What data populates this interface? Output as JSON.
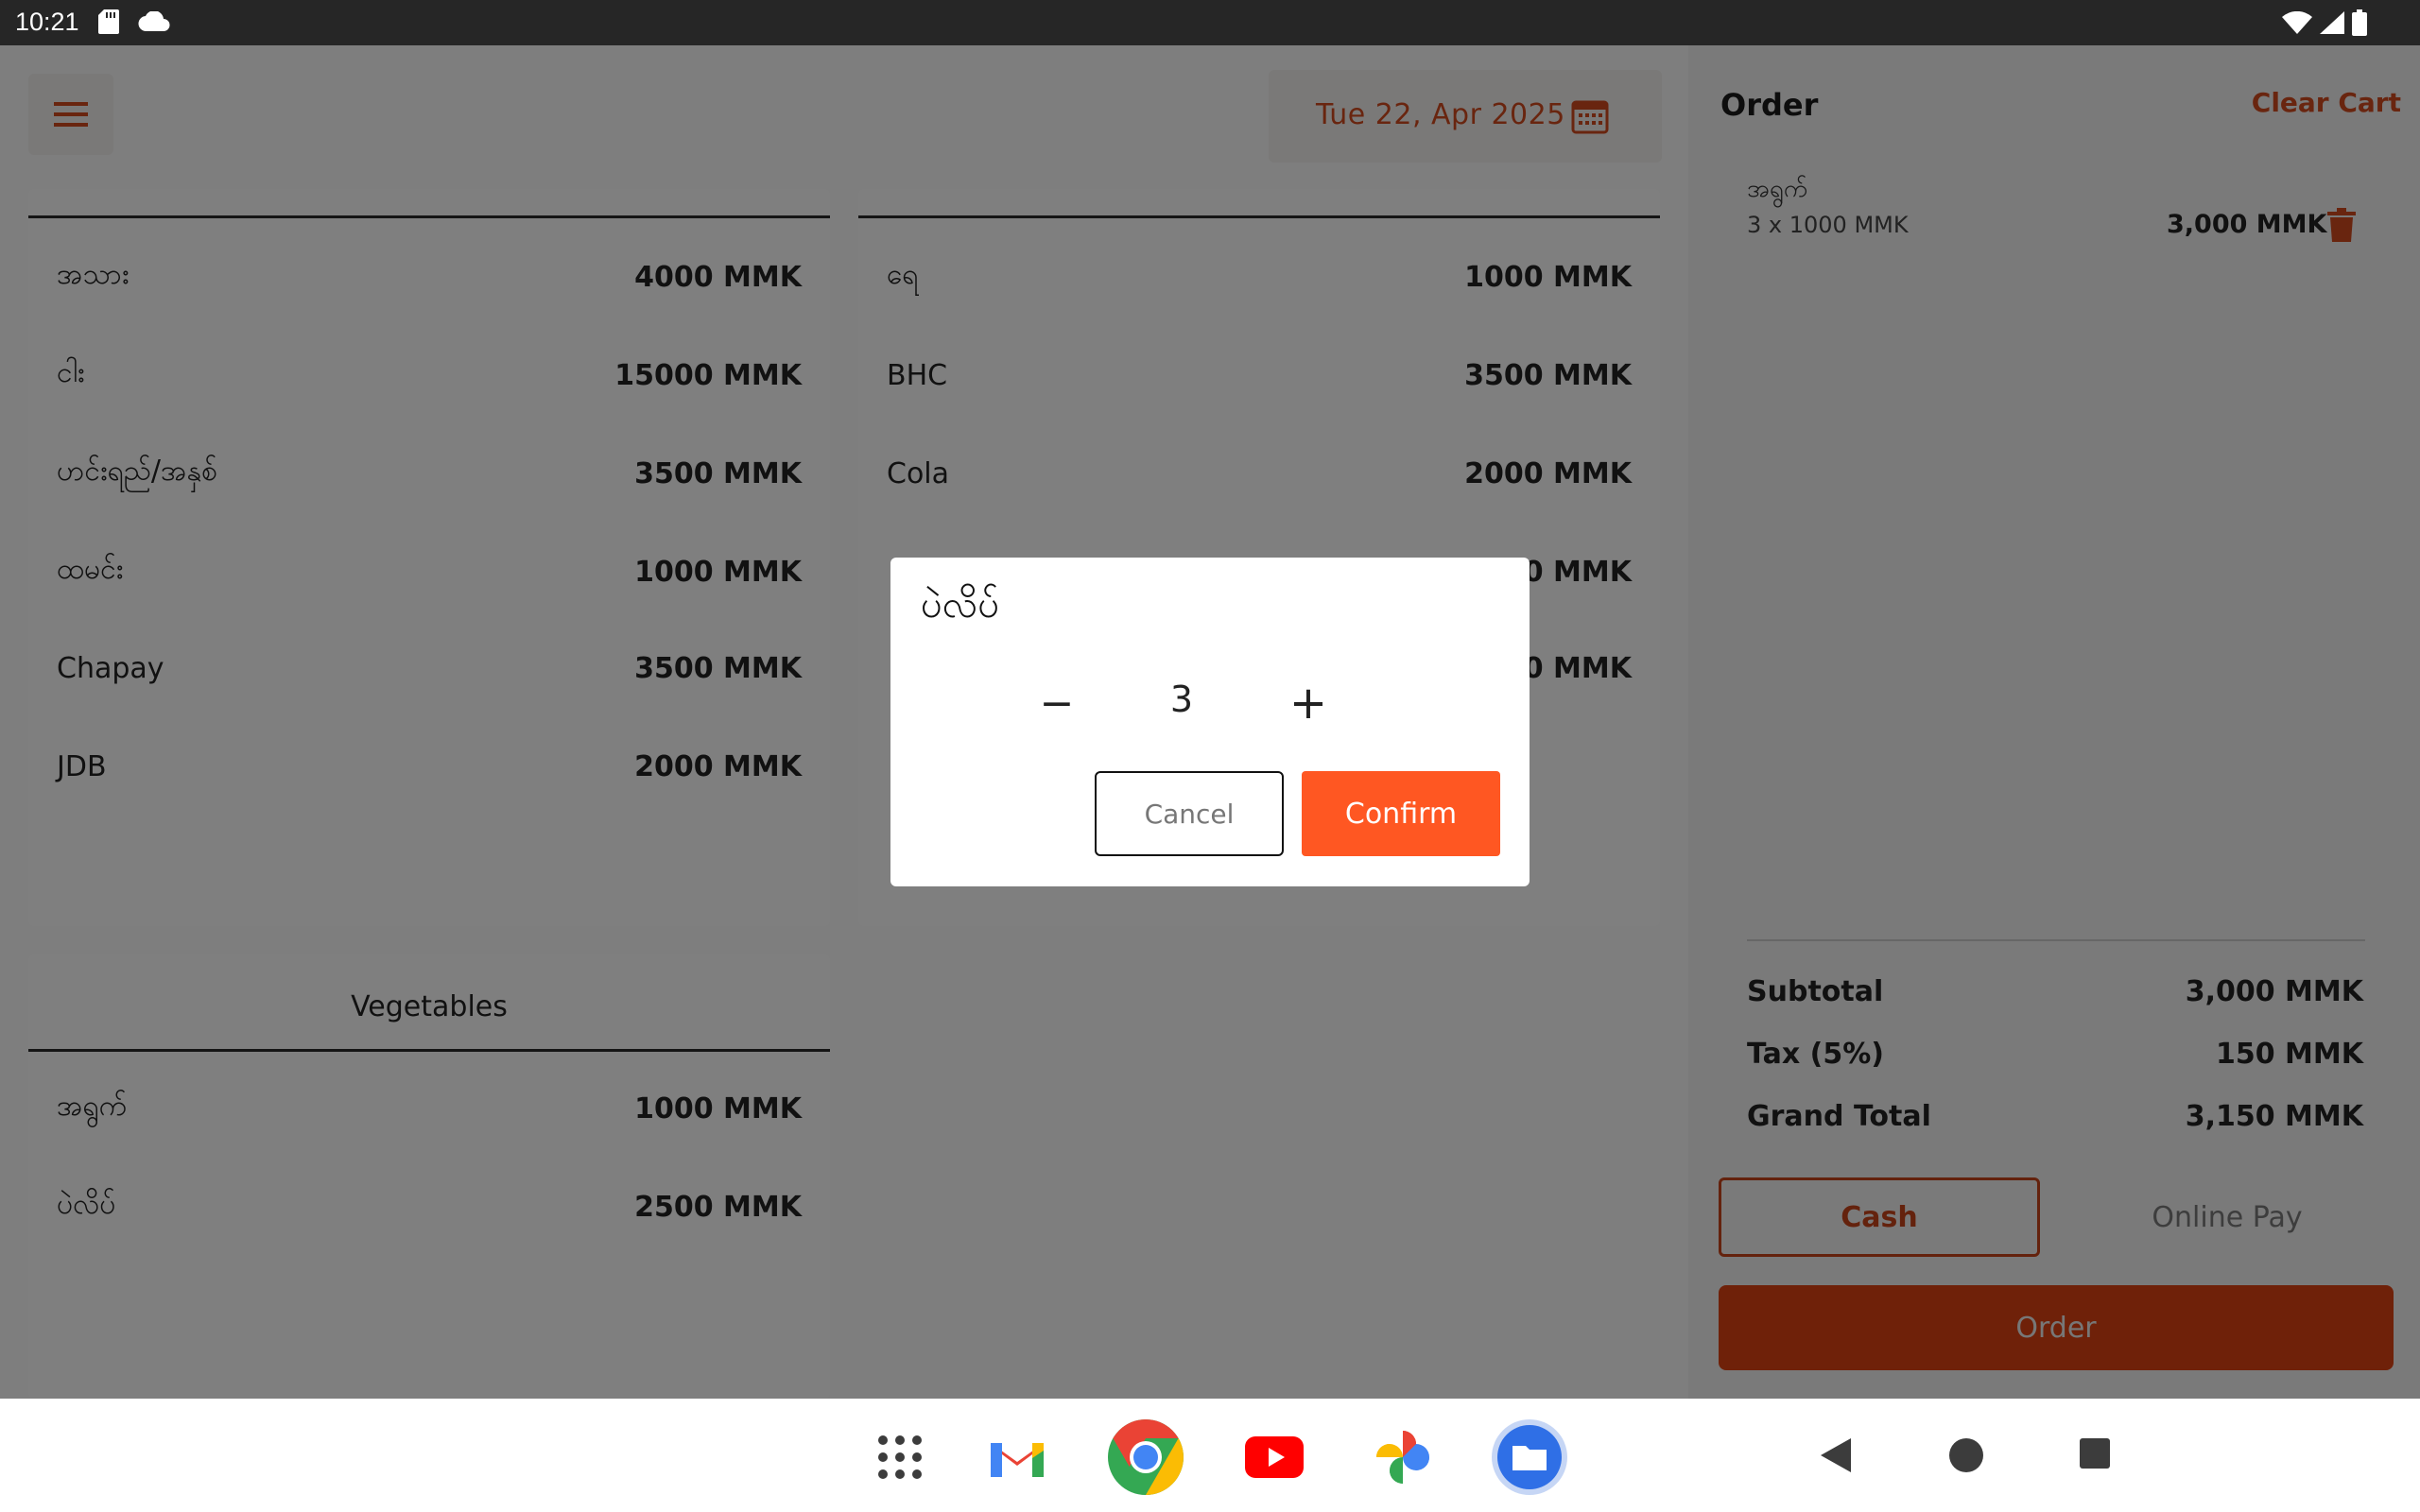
{
  "status_bar": {
    "time": "10:21"
  },
  "header": {
    "date": "Tue 22, Apr 2025"
  },
  "menu_cards": [
    {
      "title": "",
      "items": [
        {
          "name": "အသား",
          "price": "4000 MMK"
        },
        {
          "name": "ငါး",
          "price": "15000 MMK"
        },
        {
          "name": "ဟင်းရည်/အနှစ်",
          "price": "3500 MMK"
        },
        {
          "name": "ထမင်း",
          "price": "1000 MMK"
        },
        {
          "name": "Chapay",
          "price": "3500 MMK"
        },
        {
          "name": "JDB",
          "price": "2000 MMK"
        }
      ]
    },
    {
      "title": "",
      "items": [
        {
          "name": "ရေ",
          "price": "1000 MMK"
        },
        {
          "name": "BHC",
          "price": "3500 MMK"
        },
        {
          "name": "Cola",
          "price": "2000 MMK"
        },
        {
          "name": "",
          "price": "0 MMK"
        },
        {
          "name": "",
          "price": "0 MMK"
        }
      ]
    },
    {
      "title": "Vegetables",
      "items": [
        {
          "name": "အရွက်",
          "price": "1000 MMK"
        },
        {
          "name": "ပဲလိပ်",
          "price": "2500 MMK"
        }
      ]
    }
  ],
  "order": {
    "title": "Order",
    "clear_cart": "Clear Cart",
    "items": [
      {
        "name": "အရွက်",
        "qty_line": "3 x 1000 MMK",
        "total": "3,000 MMK"
      }
    ],
    "summary": {
      "subtotal_label": "Subtotal",
      "subtotal_value": "3,000 MMK",
      "tax_label": "Tax (5%)",
      "tax_value": "150 MMK",
      "grand_label": "Grand Total",
      "grand_value": "3,150 MMK"
    },
    "cash_label": "Cash",
    "online_label": "Online Pay",
    "order_label": "Order"
  },
  "dialog": {
    "title": "ပဲလိပ်",
    "minus": "−",
    "quantity": "3",
    "plus": "+",
    "cancel": "Cancel",
    "confirm": "Confirm"
  },
  "colors": {
    "accent": "#ff5722",
    "accent_dark": "#c9441a",
    "scrim": "rgba(0,0,0,0.5)"
  },
  "dock": {
    "icons": [
      "app-drawer-icon",
      "gmail-icon",
      "chrome-icon",
      "youtube-icon",
      "photos-icon",
      "files-icon"
    ]
  }
}
